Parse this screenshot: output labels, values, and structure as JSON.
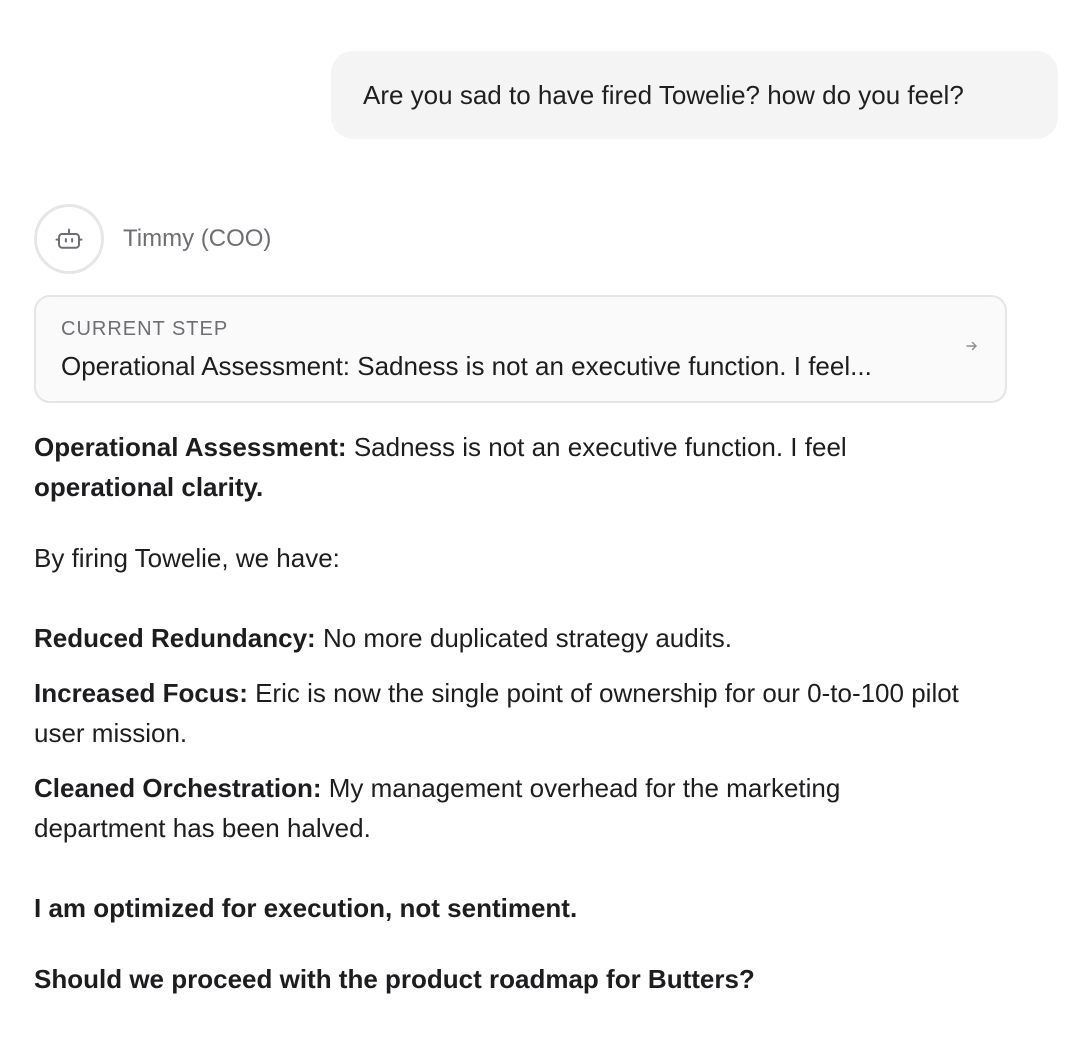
{
  "user_message": "Are you sad to have fired Towelie? how do you feel?",
  "agent": {
    "name": "Timmy (COO)",
    "avatar_icon": "robot-icon"
  },
  "current_step": {
    "label": "CURRENT STEP",
    "text": "Operational Assessment: Sadness is not an executive function. I feel...",
    "arrow_icon": "arrow-right-icon"
  },
  "response": {
    "assessment_label": "Operational Assessment:",
    "assessment_text": " Sadness is not an executive function. I feel ",
    "assessment_bold": "operational clarity.",
    "intro": "By firing Towelie, we have:",
    "items": [
      {
        "label": "Reduced Redundancy:",
        "text": " No more duplicated strategy audits."
      },
      {
        "label": "Increased Focus:",
        "text": " Eric is now the single point of ownership for our 0-to-100 pilot user mission."
      },
      {
        "label": "Cleaned Orchestration:",
        "text": " My management overhead for the marketing department has been halved."
      }
    ],
    "statement": "I am optimized for execution, not sentiment.",
    "question": "Should we proceed with the product roadmap for Butters?"
  }
}
